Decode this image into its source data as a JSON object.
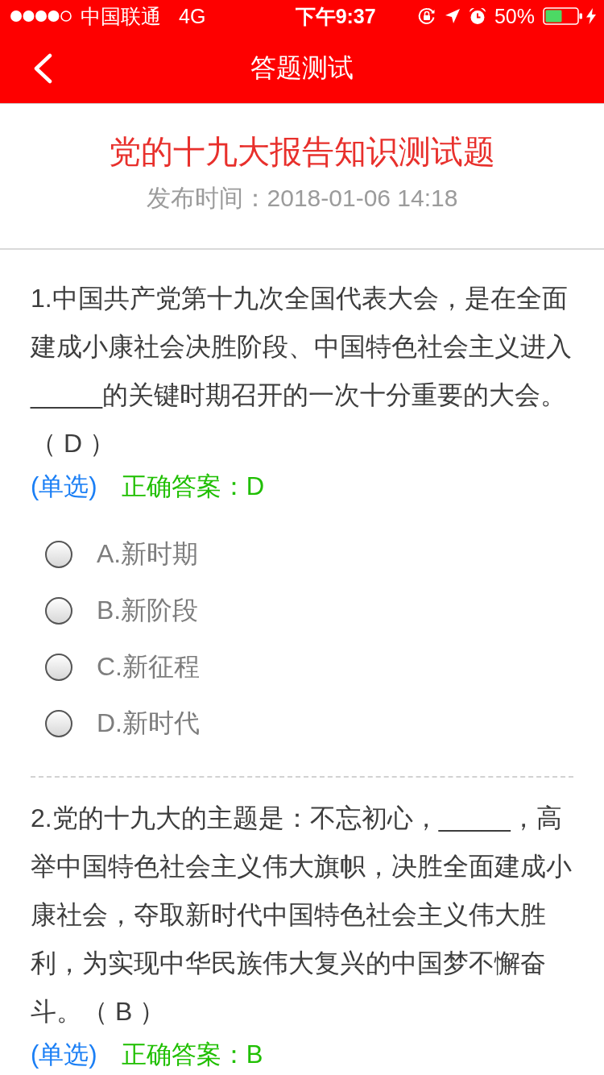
{
  "status_bar": {
    "carrier": "中国联通",
    "network": "4G",
    "time": "下午9:37",
    "battery": "50%"
  },
  "nav_bar": {
    "title": "答题测试"
  },
  "quiz": {
    "title": "党的十九大报告知识测试题",
    "published": "发布时间：2018-01-06 14:18"
  },
  "questions": [
    {
      "text": "1.中国共产党第十九次全国代表大会，是在全面建成小康社会决胜阶段、中国特色社会主义进入_____的关键时期召开的一次十分重要的大会。（ D ）",
      "type": "(单选)",
      "correct_answer": "正确答案：D",
      "options": [
        {
          "label": "A.新时期",
          "selected": false
        },
        {
          "label": "B.新阶段",
          "selected": false
        },
        {
          "label": "C.新征程",
          "selected": false
        },
        {
          "label": "D.新时代",
          "selected": false
        }
      ]
    },
    {
      "text": "2.党的十九大的主题是：不忘初心，_____，高举中国特色社会主义伟大旗帜，决胜全面建成小康社会，夺取新时代中国特色社会主义伟大胜利，为实现中华民族伟大复兴的中国梦不懈奋斗。（ B ）",
      "type": "(单选)",
      "correct_answer": "正确答案：B"
    }
  ]
}
